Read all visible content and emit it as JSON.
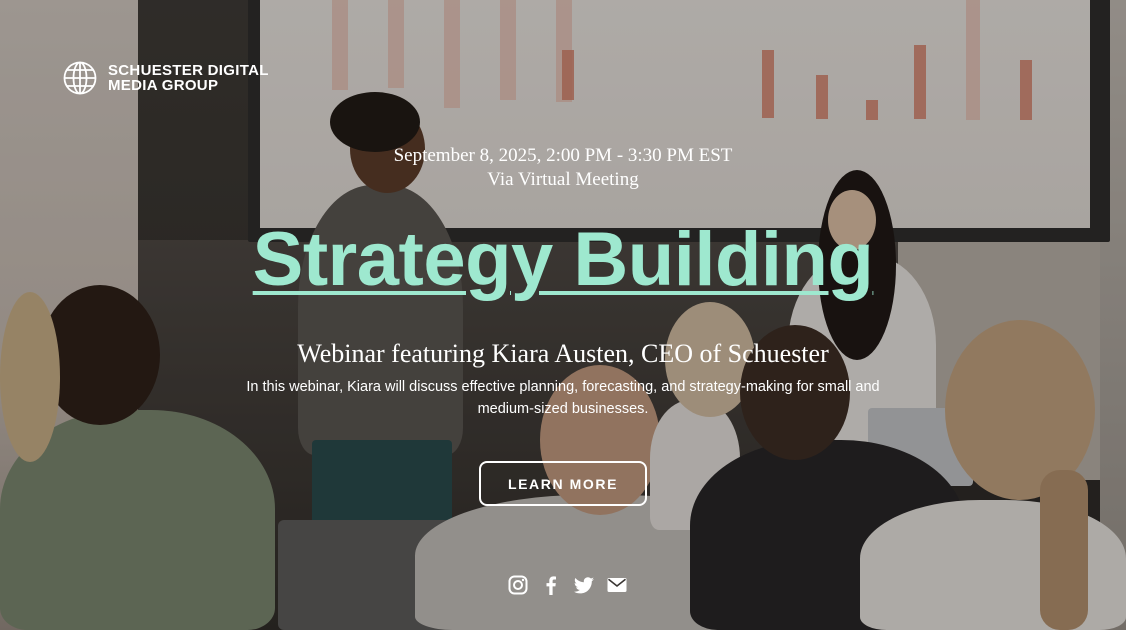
{
  "brand": {
    "name_line1": "SCHUESTER DIGITAL",
    "name_line2": "MEDIA GROUP",
    "logo_icon": "globe-icon"
  },
  "event": {
    "date_time": "September 8, 2025, 2:00 PM - 3:30 PM EST",
    "venue": "Via Virtual Meeting",
    "title": "Strategy Building",
    "subtitle": "Webinar featuring Kiara Austen, CEO of Schuester",
    "description": "In this webinar, Kiara will discuss effective planning, forecasting, and strategy-making for small and medium-sized businesses."
  },
  "cta": {
    "label": "LEARN MORE"
  },
  "social": [
    {
      "name": "instagram-icon"
    },
    {
      "name": "facebook-icon"
    },
    {
      "name": "twitter-icon"
    },
    {
      "name": "mail-icon"
    }
  ],
  "colors": {
    "accent": "#9ee8cf",
    "text": "#ffffff"
  }
}
